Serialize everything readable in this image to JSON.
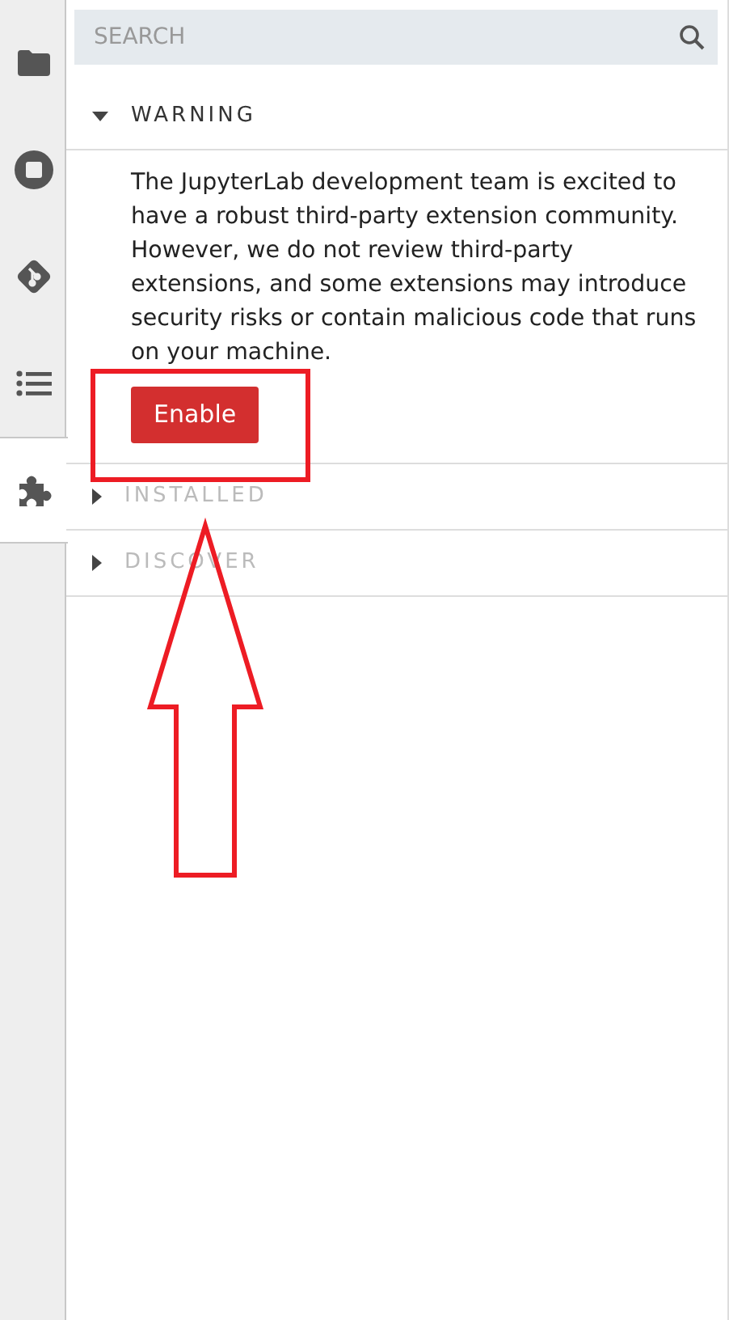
{
  "sidebar": {
    "tabs": [
      {
        "selected": false
      },
      {
        "selected": false
      },
      {
        "selected": false
      },
      {
        "selected": false
      },
      {
        "selected": true
      }
    ]
  },
  "search": {
    "placeholder": "SEARCH"
  },
  "sections": [
    {
      "title": "WARNING",
      "expanded": true,
      "disabled": false,
      "body": "The JupyterLab development team is excited to have a robust third-party extension community. However, we do not review third-party extensions, and some extensions may introduce security risks or contain malicious code that runs on your machine.",
      "button": "Enable"
    },
    {
      "title": "INSTALLED",
      "expanded": false,
      "disabled": true
    },
    {
      "title": "DISCOVER",
      "expanded": false,
      "disabled": true
    }
  ]
}
